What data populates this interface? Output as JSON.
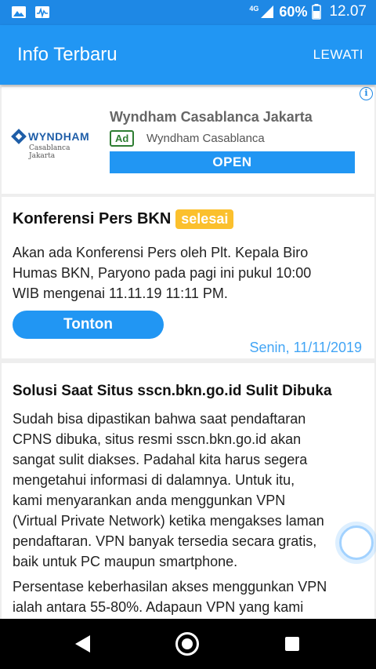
{
  "status_bar": {
    "network_label": "4G",
    "battery": "60%",
    "time": "12.07",
    "icons": [
      "image-icon",
      "activity-icon",
      "signal-icon",
      "battery-icon"
    ]
  },
  "app_bar": {
    "title": "Info Terbaru",
    "action": "LEWATI"
  },
  "ad": {
    "info_icon": "i",
    "logo_text": "WYNDHAM",
    "logo_subtext": "Casablanca Jakarta",
    "title": "Wyndham Casablanca Jakarta",
    "badge": "Ad",
    "advertiser": "Wyndham Casablanca",
    "cta": "OPEN"
  },
  "news": [
    {
      "title": "Konferensi Pers BKN",
      "status": "selesai",
      "body_lines": [
        "Akan ada Konferensi Pers oleh Plt. Kepala Biro",
        "Humas BKN, Paryono pada pagi ini pukul 10:00",
        "WIB mengenai 11.11.19 11:11 PM."
      ],
      "button": "Tonton",
      "date": "Senin, 11/11/2019"
    },
    {
      "title": "Solusi Saat Situs sscn.bkn.go.id Sulit Dibuka",
      "para1_lines": [
        "Sudah bisa dipastikan bahwa saat pendaftaran",
        "CPNS dibuka, situs resmi sscn.bkn.go.id akan",
        "sangat sulit diakses. Padahal kita harus segera",
        "mengetahui informasi di dalamnya. Untuk itu,",
        "kami menyarankan anda menggunkan VPN",
        "(Virtual Private Network) ketika mengakses laman",
        "pendaftaran. VPN banyak tersedia secara gratis,",
        "baik untuk PC maupun smartphone."
      ],
      "para2_lines": [
        "Persentase keberhasilan akses menggunkan VPN",
        "ialah antara 55-80%. Adapaun VPN yang kami"
      ]
    }
  ],
  "colors": {
    "status_bar": "#1E88E5",
    "app_bar": "#2196F3",
    "badge_yellow": "#FBC02D",
    "date_blue": "#42A5F5",
    "ad_green": "#2e7d32"
  },
  "nav_bar": {
    "icons": [
      "back-icon",
      "home-icon",
      "recents-icon"
    ]
  }
}
